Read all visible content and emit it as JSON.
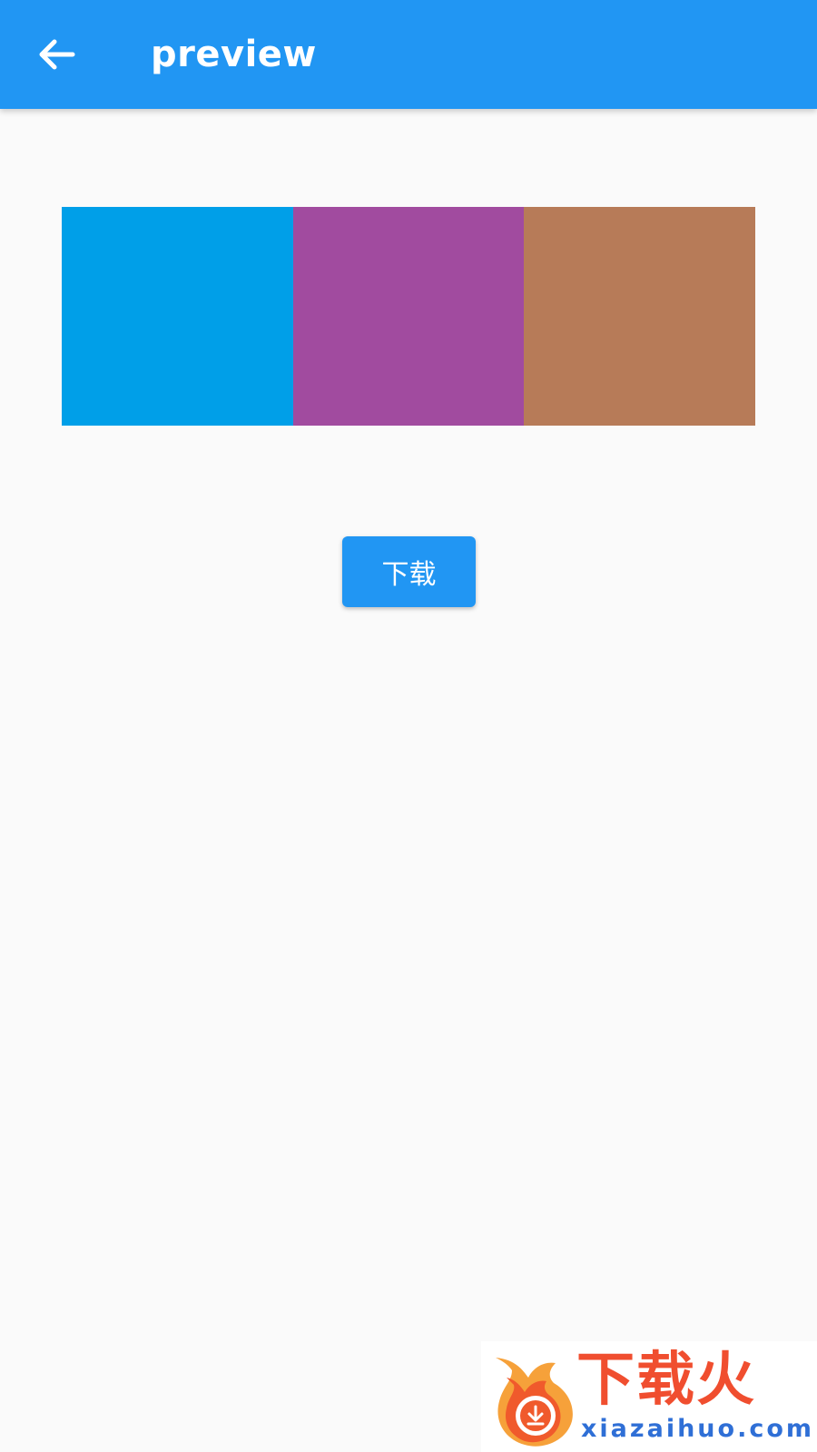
{
  "app_bar": {
    "title": "preview",
    "back_icon": "arrow-back-icon",
    "background": "#2196f3"
  },
  "preview": {
    "swatches": [
      {
        "color": "#009fe8"
      },
      {
        "color": "#a14b9f"
      },
      {
        "color": "#b77b58"
      }
    ]
  },
  "download": {
    "label": "下载",
    "background": "#2196f3"
  },
  "watermark": {
    "text": "下载火",
    "domain": "xiazaihuo.com",
    "icon": "flame-download-icon"
  }
}
